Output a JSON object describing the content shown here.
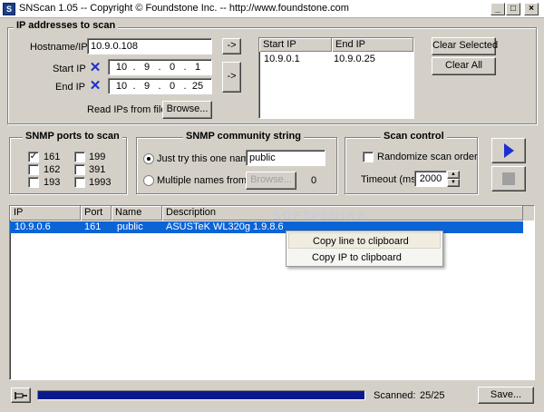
{
  "window": {
    "title": "SNScan 1.05  --  Copyright © Foundstone Inc.  --  http://www.foundstone.com",
    "minimize": "_",
    "maximize": "□",
    "close": "×"
  },
  "ip_group": {
    "title": "IP addresses to scan",
    "hostname_label": "Hostname/IP",
    "hostname_value": "10.9.0.108",
    "hostname_arrow": "->",
    "start_label": "Start IP",
    "start_ip": [
      "10",
      "9",
      "0",
      "1"
    ],
    "end_label": "End IP",
    "end_ip": [
      "10",
      "9",
      "0",
      "25"
    ],
    "range_arrow": "->",
    "read_label": "Read IPs from file",
    "browse": "Browse...",
    "clear_selected": "Clear Selected",
    "clear_all": "Clear All",
    "range_list": {
      "headers": [
        "Start IP",
        "End IP"
      ],
      "rows": [
        [
          "10.9.0.1",
          "10.9.0.25"
        ]
      ]
    }
  },
  "snmp_ports": {
    "title": "SNMP ports to scan",
    "ports": [
      {
        "label": "161",
        "checked": true
      },
      {
        "label": "199",
        "checked": false
      },
      {
        "label": "162",
        "checked": false
      },
      {
        "label": "391",
        "checked": false
      },
      {
        "label": "193",
        "checked": false
      },
      {
        "label": "1993",
        "checked": false
      }
    ]
  },
  "community": {
    "title": "SNMP community string",
    "just_try_label": "Just try this one name",
    "just_try_value": "public",
    "multiple_label": "Multiple names from list",
    "browse": "Browse...",
    "count": "0"
  },
  "scan_control": {
    "title": "Scan control",
    "randomize_label": "Randomize scan order",
    "timeout_label": "Timeout (ms)",
    "timeout_value": "2000"
  },
  "results": {
    "headers": [
      "IP",
      "Port",
      "Name",
      "Description"
    ],
    "rows": [
      {
        "ip": "10.9.0.6",
        "port": "161",
        "name": "public",
        "description": "ASUSTeK WL320g 1.9.8.6"
      }
    ],
    "watermark": "SOFTPEDIA®"
  },
  "context_menu": {
    "items": [
      "Copy line to clipboard",
      "Copy IP to clipboard"
    ]
  },
  "status": {
    "pin_icon": "pin-icon",
    "progress": 1.0,
    "scanned_label": "Scanned:",
    "scanned_value": "25/25",
    "save": "Save..."
  },
  "colors": {
    "selection": "#0a64d6",
    "progress": "#0a1a8c",
    "start_icon": "#1d2fd0"
  }
}
